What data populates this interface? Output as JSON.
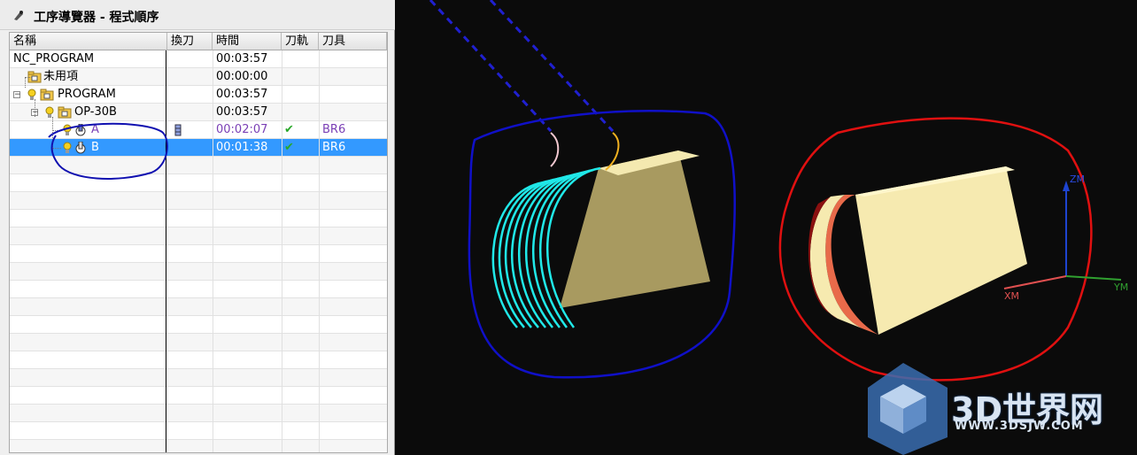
{
  "window": {
    "title": "工序導覽器 - 程式順序",
    "title_icon": "navigator-icon"
  },
  "columns": [
    "名稱",
    "換刀",
    "時間",
    "刀軌",
    "刀具"
  ],
  "rows": [
    {
      "name": "NC_PROGRAM",
      "time": "00:03:57",
      "toolpath": "",
      "tool": ""
    },
    {
      "name": "未用項",
      "time": "00:00:00",
      "toolpath": "",
      "tool": ""
    },
    {
      "name": "PROGRAM",
      "time": "00:03:57",
      "toolpath": "",
      "tool": ""
    },
    {
      "name": "OP-30B",
      "time": "00:03:57",
      "toolpath": "",
      "tool": ""
    },
    {
      "name": "A",
      "time": "00:02:07",
      "toolpath": "✔",
      "tool": "BR6"
    },
    {
      "name": "B",
      "time": "00:01:38",
      "toolpath": "✔",
      "tool": "BR6"
    }
  ],
  "selected_row": "B",
  "viewport": {
    "axes": {
      "z": "ZM",
      "x": "XM",
      "y": "YM"
    },
    "colors": {
      "highlight_circle": "#1010c8",
      "red_circle": "#e01010",
      "toolpath": "#20e0e0",
      "part": "#a89a60"
    }
  },
  "watermark": {
    "text": "3D世界网",
    "url": "WWW.3DSJW.COM"
  }
}
